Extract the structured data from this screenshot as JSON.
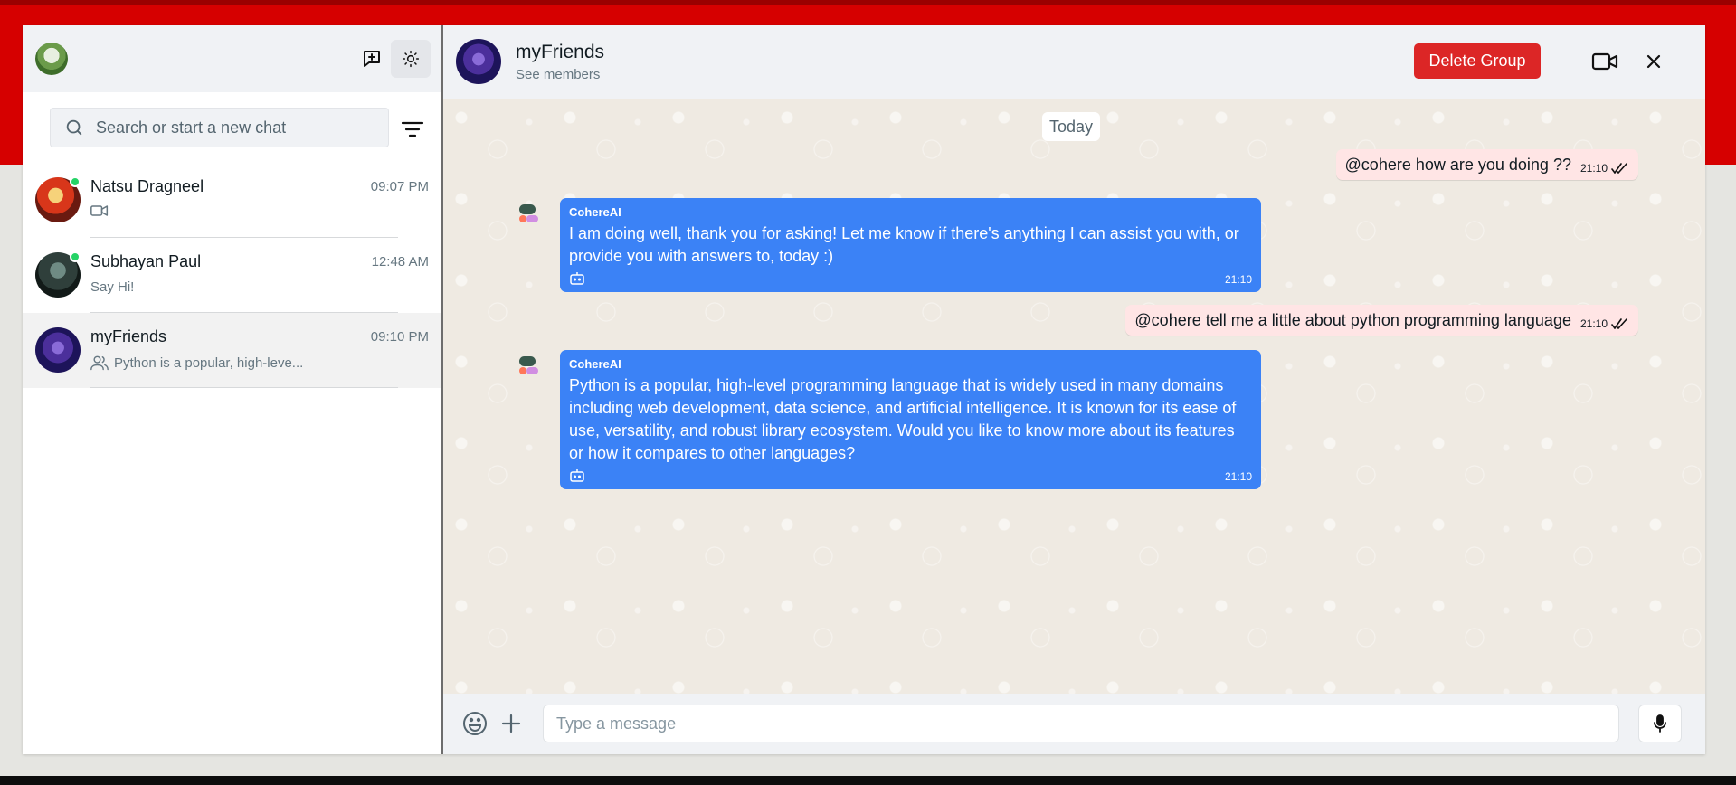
{
  "colors": {
    "accent_red": "#d60000",
    "delete_button": "#dc2626",
    "bot_bubble": "#3b82f6",
    "outgoing_bubble": "#ffe5e5",
    "online_dot": "#25d366"
  },
  "sidebar": {
    "header": {
      "avatar_icon": "user-avatar",
      "new_chat_icon": "new-chat-icon",
      "theme_icon": "sun-icon"
    },
    "search": {
      "placeholder": "Search or start a new chat"
    },
    "chats": [
      {
        "name": "Natsu Dragneel",
        "time": "09:07 PM",
        "preview": "",
        "preview_icon": "video-icon",
        "online": true
      },
      {
        "name": "Subhayan Paul",
        "time": "12:48 AM",
        "preview": "Say Hi!",
        "online": true
      },
      {
        "name": "myFriends",
        "time": "09:10 PM",
        "preview": "Python is a popular, high-leve...",
        "preview_icon": "group-icon",
        "online": false,
        "active": true
      }
    ]
  },
  "conversation": {
    "title": "myFriends",
    "subtitle": "See members",
    "delete_label": "Delete Group",
    "date_divider": "Today",
    "messages": [
      {
        "direction": "out",
        "text": "@cohere how are you doing ??",
        "time": "21:10",
        "status": "read"
      },
      {
        "direction": "in",
        "sender": "CohereAI",
        "text": "I am doing well, thank you for asking! Let me know if there's anything I can assist you with, or provide you with answers to, today :)",
        "time": "21:10"
      },
      {
        "direction": "out",
        "text": "@cohere tell me a little about python programming language",
        "time": "21:10",
        "status": "read"
      },
      {
        "direction": "in",
        "sender": "CohereAI",
        "text": "Python is a popular, high-level programming language that is widely used in many domains including web development, data science, and artificial intelligence. It is known for its ease of use, versatility, and robust library ecosystem. Would you like to know more about its features or how it compares to other languages?",
        "time": "21:10"
      }
    ]
  },
  "composer": {
    "placeholder": "Type a message"
  }
}
